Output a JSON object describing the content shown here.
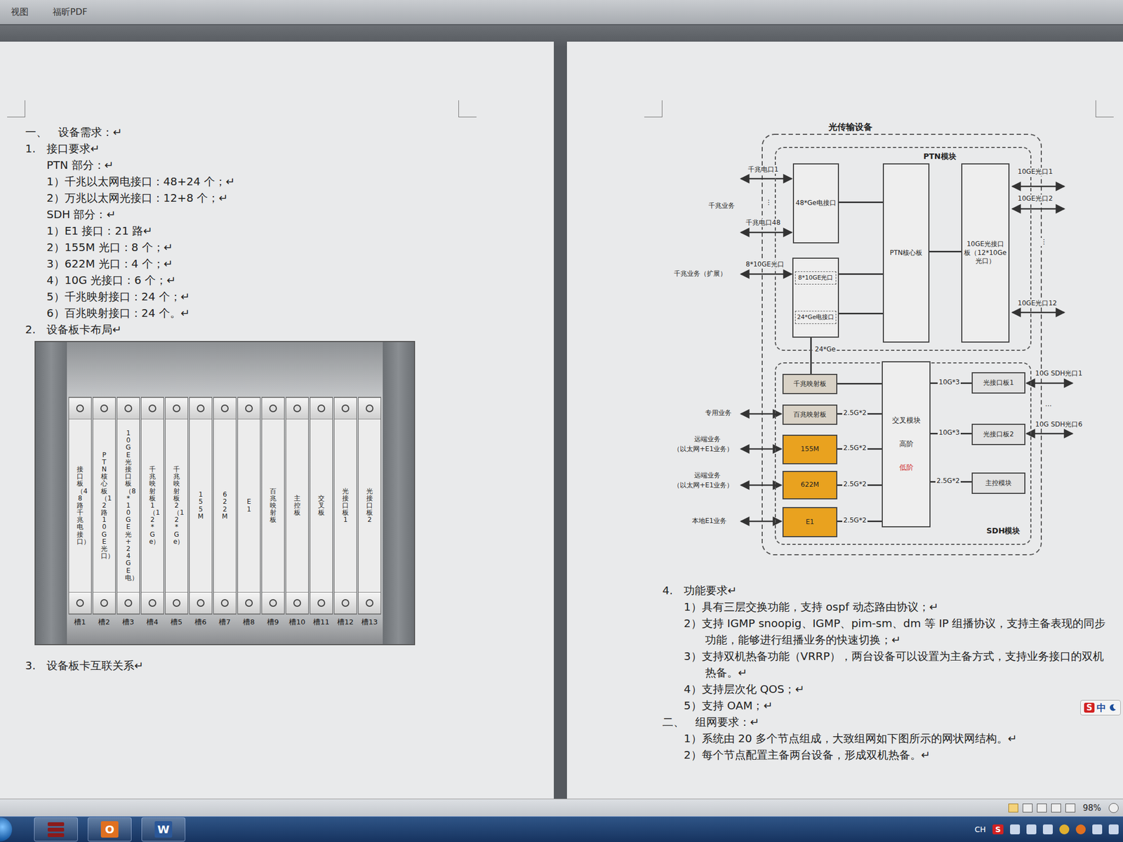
{
  "menu": [
    {
      "label": "视图"
    },
    {
      "label": "福昕PDF"
    }
  ],
  "left_page": {
    "lines_before": [
      {
        "kind": "section",
        "text": "一、　设备需求：↵"
      },
      {
        "kind": "section",
        "text": "1.　接口要求↵"
      },
      {
        "kind": "item",
        "text": "PTN 部分：↵"
      },
      {
        "kind": "item",
        "text": "1）千兆以太网电接口：48+24 个；↵"
      },
      {
        "kind": "item",
        "text": "2）万兆以太网光接口：12+8 个；↵"
      },
      {
        "kind": "item",
        "text": "SDH 部分：↵"
      },
      {
        "kind": "item",
        "text": "1）E1 接口：21 路↵"
      },
      {
        "kind": "item",
        "text": "2）155M 光口：8 个；↵"
      },
      {
        "kind": "item",
        "text": "3）622M 光口：4 个；↵"
      },
      {
        "kind": "item",
        "text": "4）10G 光接口：6 个；↵"
      },
      {
        "kind": "item",
        "text": "5）千兆映射接口：24 个；↵"
      },
      {
        "kind": "item",
        "text": "6）百兆映射接口：24 个。↵"
      },
      {
        "kind": "section",
        "text": "2.　设备板卡布局↵"
      }
    ],
    "chassis": {
      "slots": [
        {
          "label": "接口板（48路千兆电接口）",
          "number": "槽1"
        },
        {
          "label": "PTN核心板（12路10GE光口）",
          "number": "槽2"
        },
        {
          "label": "10GE光接口板（8*10GE光+24GE电）",
          "number": "槽3"
        },
        {
          "label": "千兆映射板1（12*Ge）",
          "number": "槽4"
        },
        {
          "label": "千兆映射板2（12*Ge）",
          "number": "槽5"
        },
        {
          "label": "155M",
          "number": "槽6"
        },
        {
          "label": "622M",
          "number": "槽7"
        },
        {
          "label": "E1",
          "number": "槽8"
        },
        {
          "label": "百兆映射板",
          "number": "槽9"
        },
        {
          "label": "主控板",
          "number": "槽10"
        },
        {
          "label": "交叉板",
          "number": "槽11"
        },
        {
          "label": "光接口板1",
          "number": "槽12"
        },
        {
          "label": "光接口板2",
          "number": "槽13"
        }
      ]
    },
    "lines_after": [
      {
        "kind": "section",
        "text": "3.　设备板卡互联关系↵"
      }
    ]
  },
  "right_page": {
    "diagram": {
      "title": "光传输设备",
      "groups": [
        {
          "label": "PTN模块"
        },
        {
          "label": "SDH模块"
        }
      ],
      "boards": [
        {
          "kind": "box",
          "text": "48*Ge电接口",
          "color": "#eeeeee"
        },
        {
          "kind": "split",
          "parts": [
            "8*10GE光口",
            "24*Ge电接口"
          ],
          "color": "#eeeeee"
        },
        {
          "kind": "box",
          "text": "PTN核心板",
          "color": "#eeeeee"
        },
        {
          "kind": "box",
          "text": "10GE光接口板（12*10Ge光口）",
          "color": "#eeeeee"
        },
        {
          "kind": "box",
          "text": "千兆映射板",
          "color": "#d9d2c6"
        },
        {
          "kind": "box",
          "text": "百兆映射板",
          "color": "#d9d2c6"
        },
        {
          "kind": "box",
          "text": "155M",
          "color": "#e9a21f"
        },
        {
          "kind": "box",
          "text": "622M",
          "color": "#e9a21f"
        },
        {
          "kind": "box",
          "text": "E1",
          "color": "#e9a21f"
        },
        {
          "kind": "cross",
          "text": "交叉模块",
          "color": "#eeeeee",
          "tiers": [
            {
              "text": "高阶",
              "color": "#333333"
            },
            {
              "text": "低阶",
              "color": "#d03030"
            }
          ]
        },
        {
          "kind": "box",
          "text": "光接口板1",
          "color": "#e2e2e2"
        },
        {
          "kind": "box",
          "text": "光接口板2",
          "color": "#e2e2e2"
        },
        {
          "kind": "box",
          "text": "主控模块",
          "color": "#e2e2e2"
        }
      ],
      "labels": [
        {
          "text": "千兆电口1"
        },
        {
          "text": "千兆电口48"
        },
        {
          "text": "千兆业务"
        },
        {
          "text": "8*10GE光口"
        },
        {
          "text": "千兆业务（扩展）"
        },
        {
          "text": "24*Ge"
        },
        {
          "text": "10GE光口1"
        },
        {
          "text": "10GE光口2"
        },
        {
          "text": "10GE光口12"
        },
        {
          "text": "10G SDH光口1"
        },
        {
          "text": "10G SDH光口6"
        },
        {
          "text": "专用业务"
        },
        {
          "text": "远端业务"
        },
        {
          "text": "（以太网+E1业务）"
        },
        {
          "text": "远端业务"
        },
        {
          "text": "（以太网+E1业务）"
        },
        {
          "text": "本地E1业务"
        },
        {
          "text": "2.5G*2"
        },
        {
          "text": "2.5G*2"
        },
        {
          "text": "2.5G*2"
        },
        {
          "text": "2.5G*2"
        },
        {
          "text": "10G*3"
        },
        {
          "text": "10G*3"
        },
        {
          "text": "2.5G*2"
        },
        {
          "text": "⋮"
        },
        {
          "text": "⋮"
        },
        {
          "text": "…"
        }
      ]
    },
    "lines": [
      {
        "kind": "section",
        "text": "4.　功能要求↵"
      },
      {
        "kind": "item",
        "text": "1）具有三层交换功能，支持 ospf 动态路由协议；↵"
      },
      {
        "kind": "item",
        "text": "2）支持 IGMP snoopig、IGMP、pim-sm、dm 等 IP 组播协议，支持主备表现的同步功能，能够进行组播业务的快速切换；↵"
      },
      {
        "kind": "item",
        "text": "3）支持双机热备功能（VRRP），两台设备可以设置为主备方式，支持业务接口的双机热备。↵"
      },
      {
        "kind": "item",
        "text": "4）支持层次化 QOS；↵"
      },
      {
        "kind": "item",
        "text": "5）支持 OAM；↵"
      },
      {
        "kind": "section",
        "text": "二、　组网要求：↵"
      },
      {
        "kind": "item",
        "text": "1）系统由 20 多个节点组成，大致组网如下图所示的网状网结构。↵"
      },
      {
        "kind": "item",
        "text": "2）每个节点配置主备两台设备，形成双机热备。↵"
      }
    ]
  },
  "ime": {
    "logo": "S",
    "mode": "中"
  },
  "status_bar": {
    "zoom": "98%"
  },
  "taskbar": {
    "apps": [
      {
        "kind": "stack",
        "color": "#8b1a1a"
      },
      {
        "kind": "letter",
        "glyph": "O",
        "color": "#e07020"
      },
      {
        "kind": "letter",
        "glyph": "W",
        "color": "#2b5797"
      }
    ],
    "tray": [
      {
        "kind": "text",
        "text": "CH"
      },
      {
        "kind": "badge",
        "text": "S",
        "color": "#d22222"
      }
    ]
  }
}
